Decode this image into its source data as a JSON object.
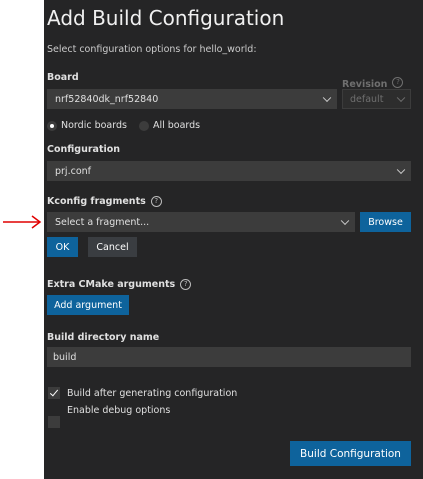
{
  "dialog": {
    "title": "Add Build Configuration",
    "subtitle": "Select configuration options for hello_world:"
  },
  "board": {
    "label": "Board",
    "value": "nrf52840dk_nrf52840",
    "radio_nordic": "Nordic boards",
    "radio_all": "All boards",
    "selected_radio": "Nordic boards"
  },
  "revision": {
    "label": "Revision",
    "value": "default"
  },
  "configuration": {
    "label": "Configuration",
    "value": "prj.conf"
  },
  "kconfig": {
    "label": "Kconfig fragments",
    "placeholder": "Select a fragment...",
    "browse_label": "Browse",
    "ok_label": "OK",
    "cancel_label": "Cancel"
  },
  "cmake": {
    "label": "Extra CMake arguments",
    "add_label": "Add argument"
  },
  "build_dir": {
    "label": "Build directory name",
    "value": "build"
  },
  "options": {
    "build_after_label": "Build after generating configuration",
    "build_after_checked": true,
    "debug_label": "Enable debug options",
    "debug_checked": false
  },
  "footer": {
    "submit_label": "Build Configuration"
  },
  "annotation": {
    "arrow_color": "#e00000"
  },
  "colors": {
    "panel_bg": "#252526",
    "input_bg": "#3c3c3c",
    "primary_button": "#0e639c",
    "secondary_button": "#3a3d41"
  }
}
